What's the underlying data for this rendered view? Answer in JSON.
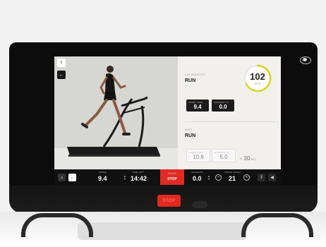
{
  "photo_panel": {
    "menu_label": "II",
    "back_label": "←"
  },
  "workout": {
    "label": "LAP WORKOUT",
    "name": "RUN",
    "gauge_value": "102",
    "gauge_unit": "BPM",
    "gauge_color": "#d9d41e",
    "current": {
      "speed_label": "SPEED / KM/H",
      "speed_value": "9.4",
      "incline_label": "GRADIENT / %",
      "incline_value": "0.0"
    }
  },
  "next": {
    "label": "NEXT",
    "name": "RUN",
    "speed_label": "SPEED / KM/H",
    "speed_value": "10.6",
    "incline_label": "GRADIENT / %",
    "incline_value": "5.0",
    "duration_prefix": "+",
    "duration_value": "30",
    "duration_unit": "SEC"
  },
  "bottom_bar": {
    "home_icon": "⌂",
    "back_icon": "←",
    "speed_label": "SPEED",
    "speed_value": "9.4",
    "time_label": "TIME LEFT",
    "time_value": "14:42",
    "stop_top": "PAUSE",
    "stop_label": "STOP",
    "incline_label": "GRADIENT",
    "incline_value": "0.0",
    "level_label": "SPEED LEVEL",
    "level_value": "21",
    "minus": "−",
    "plus": "+",
    "skip_icon": "‖",
    "volume_icon": "◀"
  },
  "console": {
    "stop_label": "STOP"
  }
}
